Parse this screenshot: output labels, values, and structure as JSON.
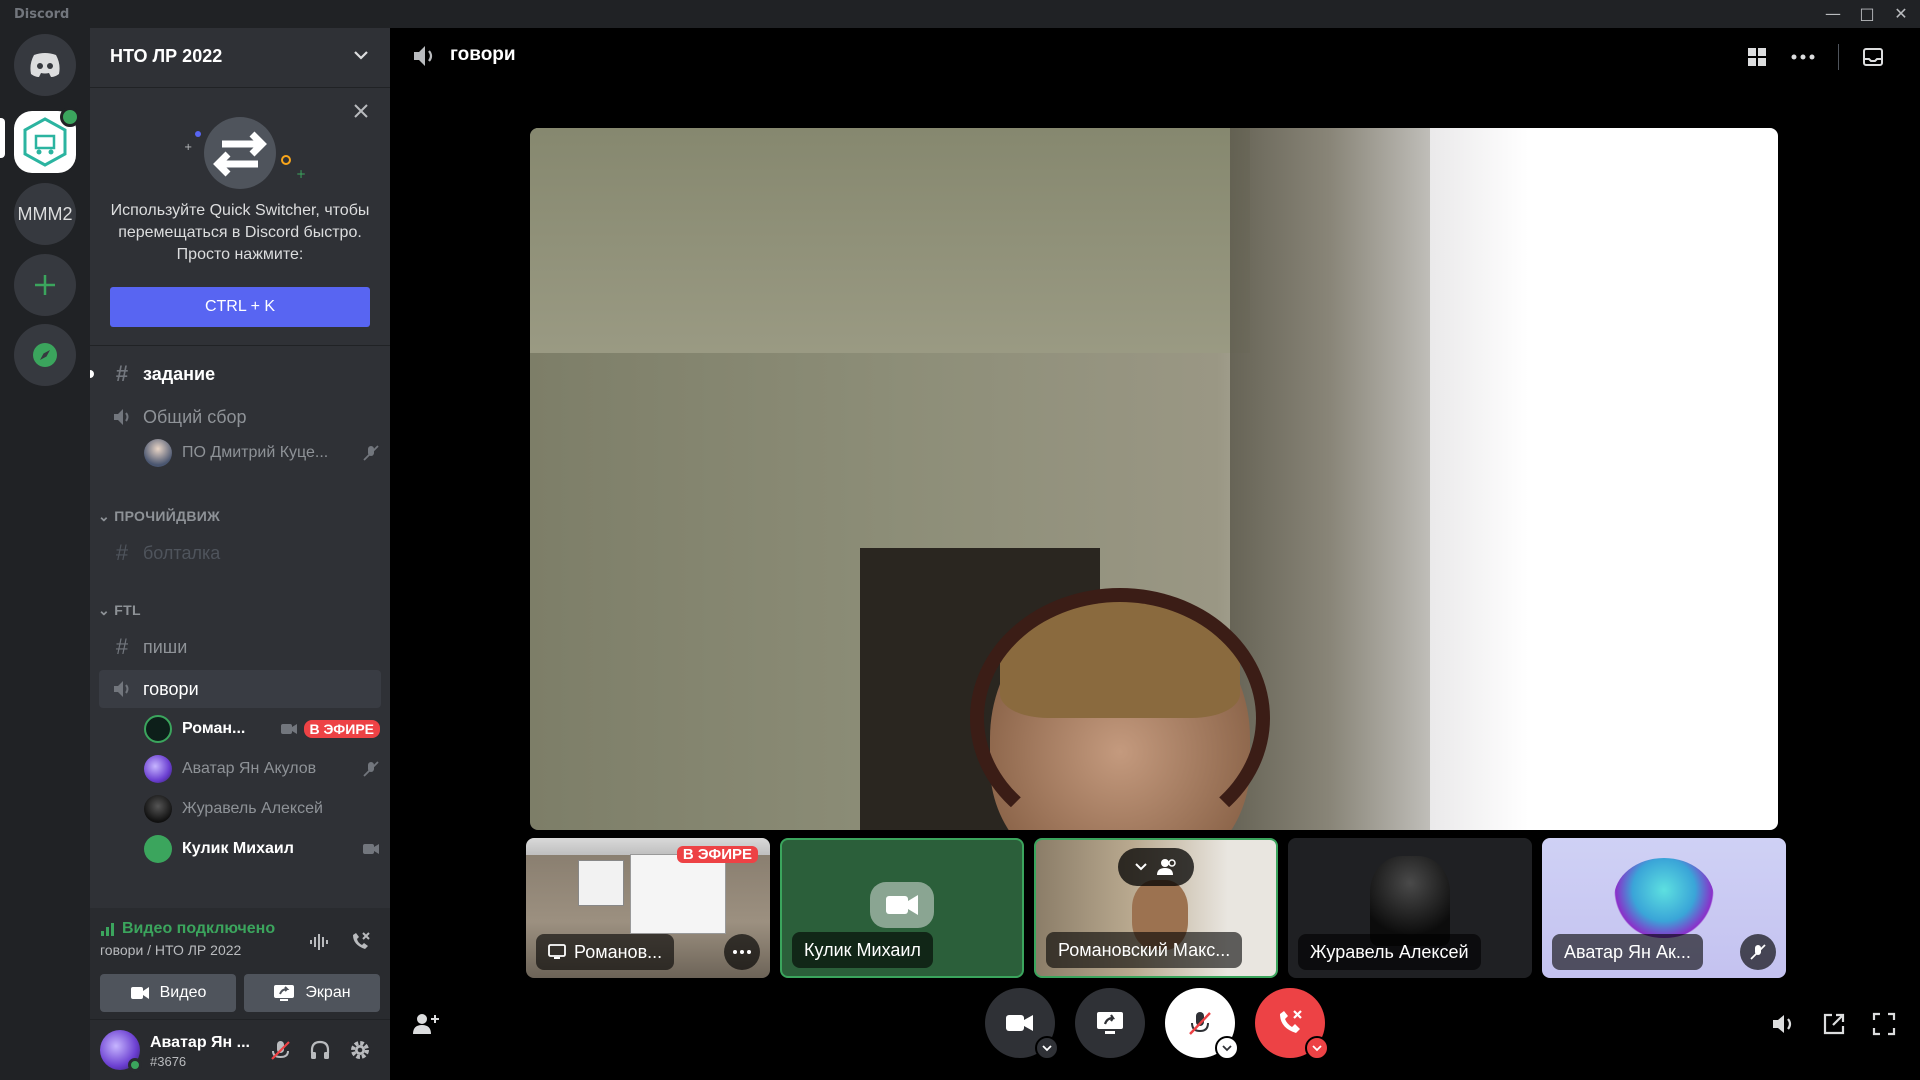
{
  "app": {
    "brand": "Discord"
  },
  "rail": {
    "server2_label": "MMM2"
  },
  "guild": {
    "name": "НТО ЛР 2022"
  },
  "quick_switcher": {
    "text": "Используйте Quick Switcher, чтобы перемещаться в Discord быстро. Просто нажмите:",
    "shortcut": "CTRL + K"
  },
  "channels": [
    {
      "type": "text",
      "name": "задание"
    },
    {
      "type": "voice",
      "name": "Общий сбор"
    }
  ],
  "general_voice_users": [
    {
      "name": "ПО Дмитрий Куце..."
    }
  ],
  "categories": {
    "misc": {
      "name": "ПРОЧИЙДВИЖ",
      "channels": [
        {
          "type": "text",
          "name": "болталка"
        }
      ]
    },
    "ftl": {
      "name": "FTL",
      "channels": [
        {
          "type": "text",
          "name": "пиши"
        },
        {
          "type": "voice",
          "name": "говори"
        }
      ]
    }
  },
  "voice_users": [
    {
      "name": "Роман...",
      "badge": "В ЭФИРЕ"
    },
    {
      "name": "Аватар Ян Акулов"
    },
    {
      "name": "Журавель Алексей"
    },
    {
      "name": "Кулик Михаил"
    }
  ],
  "voice_panel": {
    "status": "Видео подключено",
    "location": "говори / НТО ЛР 2022",
    "video_label": "Видео",
    "screen_label": "Экран"
  },
  "user_panel": {
    "name": "Аватар Ян ...",
    "tag": "#3676"
  },
  "main": {
    "channel_title": "говори"
  },
  "tiles": [
    {
      "label": "Романов...",
      "badge": "В ЭФИРЕ"
    },
    {
      "label": "Кулик Михаил"
    },
    {
      "label": "Романовский Макс..."
    },
    {
      "label": "Журавель Алексей"
    },
    {
      "label": "Аватар Ян Ак..."
    }
  ],
  "colors": {
    "accent": "#5865f2",
    "live": "#ed4245",
    "connected": "#3ba55d",
    "sidebar": "#2f3136",
    "rail": "#202225"
  },
  "icons": [
    "discord-home-icon",
    "add-server-icon",
    "explore-icon",
    "close-icon",
    "chevron-down-icon",
    "hashtag-icon",
    "speaker-icon",
    "camera-icon",
    "screen-share-icon",
    "mic-muted-icon",
    "headphones-icon",
    "settings-icon",
    "grid-icon",
    "more-icon",
    "inbox-icon",
    "hangup-icon",
    "volume-icon",
    "popout-icon",
    "fullscreen-icon",
    "add-user-icon"
  ]
}
